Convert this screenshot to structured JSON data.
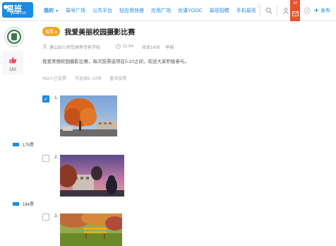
{
  "app": {
    "logo_cn": "易班",
    "logo_en": "yiban.cn"
  },
  "nav": {
    "items": [
      "我的",
      "易号广场",
      "公共平台",
      "轻应用快搭",
      "应用广场",
      "优课YOOC",
      "易班招聘",
      "手机易班"
    ]
  },
  "topbar": {
    "mail_count": "47",
    "publish_label": "发布"
  },
  "sidebar": {
    "like_count": "183"
  },
  "vote": {
    "tag": "投票",
    "title": "我爱美丽校园摄影比赛",
    "school": "唐山幼儿师范高等专科学校",
    "date": "11-04",
    "read_label": "阅读1409",
    "report_label": "举报",
    "description": "我爱美丽校园摄影比赛，每次投票选项在5-10之间，欢迎大家积极参与。",
    "voted_count": "463人已投票",
    "selectable": "可选择5~10项",
    "anonymous": "匿名投票"
  },
  "options": [
    {
      "num": "1.",
      "votes": "175票",
      "checked": true
    },
    {
      "num": "2.",
      "votes": "164票",
      "checked": false
    },
    {
      "num": "3.",
      "votes": "",
      "checked": false
    }
  ],
  "colors": {
    "accent": "#1a8be5",
    "tag": "#f5a623",
    "mail": "#e8532b",
    "like": "#e94f6a"
  }
}
